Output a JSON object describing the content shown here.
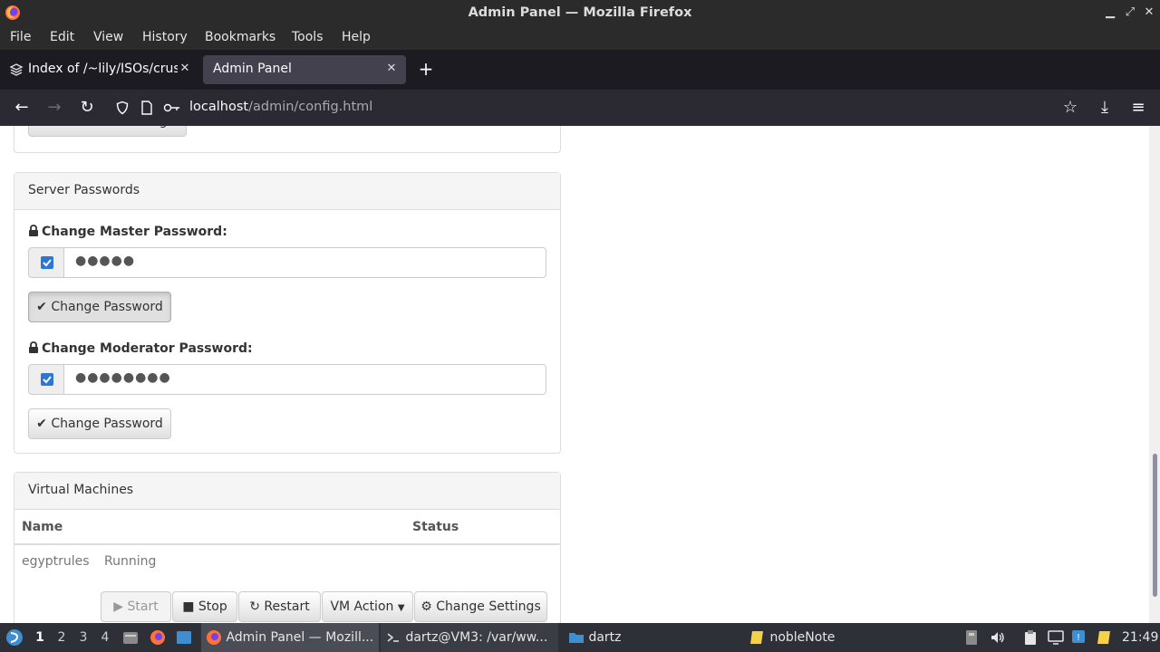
{
  "window": {
    "title": "Admin Panel — Mozilla Firefox"
  },
  "menubar": {
    "items": [
      "File",
      "Edit",
      "View",
      "History",
      "Bookmarks",
      "Tools",
      "Help"
    ]
  },
  "tabs": [
    {
      "label": "Index of /~lily/ISOs/crust",
      "active": false
    },
    {
      "label": "Admin Panel",
      "active": true
    }
  ],
  "navbar": {
    "url_host": "localhost",
    "url_path": "/admin/config.html"
  },
  "page": {
    "prev_button_label": "Save Server Settings",
    "passwords_panel": {
      "heading": "Server Passwords",
      "master": {
        "label": "Change Master Password:",
        "value": "●●●●●",
        "checked": true,
        "button_label": "Change Password"
      },
      "moderator": {
        "label": "Change Moderator Password:",
        "value": "●●●●●●●●",
        "checked": true,
        "button_label": "Change Password"
      }
    },
    "vm_panel": {
      "heading": "Virtual Machines",
      "columns": [
        "Name",
        "Status"
      ],
      "rows": [
        {
          "name": "egyptrules",
          "status": "Running"
        }
      ],
      "actions": {
        "start": "Start",
        "stop": "Stop",
        "restart": "Restart",
        "vm_action": "VM Action",
        "change_settings": "Change Settings"
      }
    }
  },
  "taskbar": {
    "workspaces": [
      "1",
      "2",
      "3",
      "4"
    ],
    "current_workspace": "1",
    "tasks": [
      {
        "label": "Admin Panel — Mozill...",
        "icon": "firefox-icon"
      },
      {
        "label": "dartz@VM3: /var/ww...",
        "icon": "terminal-icon"
      },
      {
        "label": "dartz",
        "icon": "folder-icon"
      },
      {
        "label": "nobleNote",
        "icon": "note-icon"
      }
    ],
    "clock": "21:49"
  },
  "colors": {
    "chrome_dark": "#2b2b2b",
    "tabbar": "#1c1b22",
    "navbar": "#2b2a33",
    "checkbox_blue": "#2f76d2",
    "taskbar": "#2d3037"
  }
}
